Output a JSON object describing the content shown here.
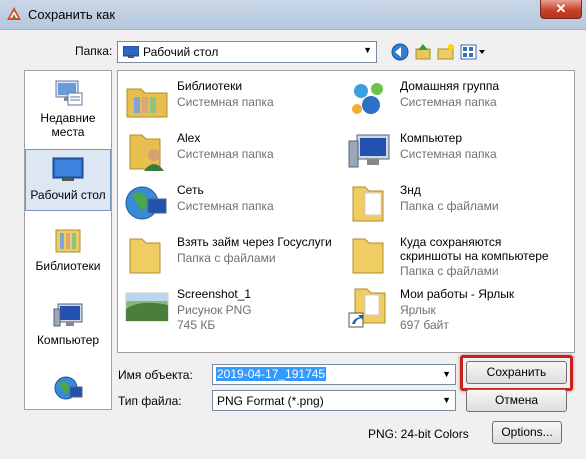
{
  "window": {
    "title": "Сохранить как",
    "close_label": "✕"
  },
  "folder": {
    "label": "Папка:",
    "current": "Рабочий стол",
    "arrow": "▼"
  },
  "places": [
    {
      "label": "Недавние места",
      "icon": "recent-places-icon"
    },
    {
      "label": "Рабочий стол",
      "icon": "desktop-icon",
      "selected": true
    },
    {
      "label": "Библиотеки",
      "icon": "libraries-icon"
    },
    {
      "label": "Компьютер",
      "icon": "computer-icon"
    },
    {
      "label": "",
      "icon": "network-icon"
    }
  ],
  "files": [
    {
      "name": "Библиотеки",
      "line2": "Системная папка",
      "icon": "libraries-icon"
    },
    {
      "name": "Домашняя группа",
      "line2": "Системная папка",
      "icon": "homegroup-icon"
    },
    {
      "name": "Alex",
      "line2": "Системная папка",
      "icon": "user-folder-icon"
    },
    {
      "name": "Компьютер",
      "line2": "Системная папка",
      "icon": "computer-icon"
    },
    {
      "name": "Сеть",
      "line2": "Системная папка",
      "icon": "network-icon"
    },
    {
      "name": "Знд",
      "line2": "Папка с файлами",
      "icon": "folder-icon"
    },
    {
      "name": "Взять займ через Госуслуги",
      "line2": "Папка с файлами",
      "icon": "folder-icon"
    },
    {
      "name": "Куда сохраняются скриншоты на компьютере",
      "name_line1": "Куда сохраняются",
      "name_line2": "скриншоты на компьютере",
      "line2": "Папка с файлами",
      "icon": "folder-icon"
    },
    {
      "name": "Screenshot_1",
      "line2": "Рисунок PNG",
      "line3": "745 КБ",
      "icon": "png-thumbnail-icon"
    },
    {
      "name": "Мои работы - Ярлык",
      "line2": "Ярлык",
      "line3": "697 байт",
      "icon": "shortcut-folder-icon"
    }
  ],
  "form": {
    "filename_label": "Имя объекта:",
    "filename_value": "2019-04-17_191745",
    "filetype_label": "Тип файла:",
    "filetype_value": "PNG Format (*.png)",
    "save_button": "Сохранить",
    "cancel_button": "Отмена",
    "options_button": "Options...",
    "info_text": "PNG: 24-bit Colors"
  },
  "colors": {
    "highlight": "#c8201c",
    "selection": "#3399ff"
  }
}
